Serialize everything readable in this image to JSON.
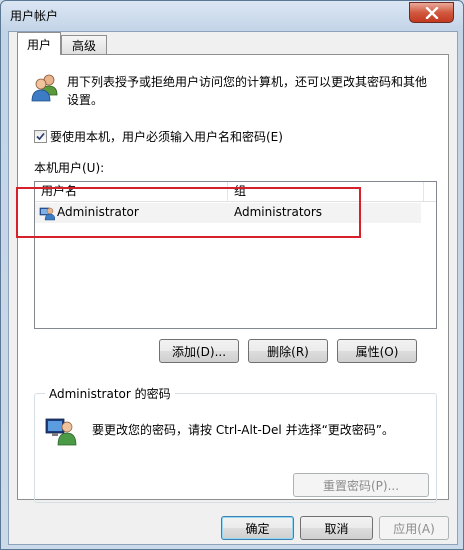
{
  "window": {
    "title": "用户帐户"
  },
  "tabs": [
    {
      "label": "用户",
      "active": true
    },
    {
      "label": "高级",
      "active": false
    }
  ],
  "description": "用下列表授予或拒绝用户访问您的计算机，还可以更改其密码和其他设置。",
  "require_login": {
    "label": "要使用本机，用户必须输入用户名和密码(E)",
    "checked": true
  },
  "local_users_label": "本机用户(U):",
  "users_table": {
    "columns": [
      "用户名",
      "组"
    ],
    "rows": [
      {
        "username": "Administrator",
        "group": "Administrators"
      }
    ]
  },
  "list_buttons": {
    "add": "添加(D)...",
    "remove": "删除(R)",
    "properties": "属性(O)"
  },
  "password_group": {
    "title": "Administrator 的密码",
    "description": "要更改您的密码，请按 Ctrl-Alt-Del 并选择“更改密码”。",
    "reset_button": "重置密码(P)..."
  },
  "footer": {
    "ok": "确定",
    "cancel": "取消",
    "apply": "应用(A)"
  },
  "icons": {
    "users": "users-icon",
    "user": "user-icon",
    "password_user": "user-password-icon",
    "close": "close-icon"
  },
  "colors": {
    "highlight_box": "#d6202a",
    "close_button": "#c2391f"
  }
}
